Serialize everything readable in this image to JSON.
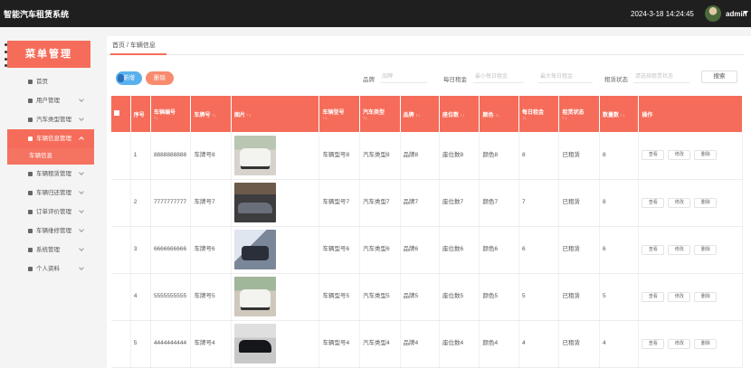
{
  "app": {
    "title": "智能汽车租赁系统",
    "datetime": "2024-3-18 14:24:45",
    "user": "admin"
  },
  "sidebar": {
    "banner": "菜单管理",
    "items": [
      {
        "label": "首页",
        "icon": "home-icon",
        "expandable": false
      },
      {
        "label": "用户管理",
        "icon": "user-icon",
        "expandable": true
      },
      {
        "label": "汽车类型管理",
        "icon": "grid-icon",
        "expandable": true
      },
      {
        "label": "车辆信息管理",
        "icon": "car-icon",
        "expandable": true,
        "active": true,
        "sub": "车辆信息"
      },
      {
        "label": "车辆租赁管理",
        "icon": "person-icon",
        "expandable": true
      },
      {
        "label": "车辆归还管理",
        "icon": "download-icon",
        "expandable": true
      },
      {
        "label": "订单评价管理",
        "icon": "grid-icon",
        "expandable": true
      },
      {
        "label": "车辆维修管理",
        "icon": "bulb-icon",
        "expandable": true
      },
      {
        "label": "系统管理",
        "icon": "chart-icon",
        "expandable": true
      },
      {
        "label": "个人资料",
        "icon": "profile-icon",
        "expandable": true
      }
    ]
  },
  "breadcrumb": "首页 / 车辆信息",
  "toolbar": {
    "add": "新增",
    "delete": "删除",
    "search": "搜索"
  },
  "filters": [
    {
      "label": "品牌",
      "placeholder": "品牌"
    },
    {
      "label": "每日租金",
      "placeholder": "最小每日租金"
    },
    {
      "label": "",
      "placeholder": "最大每日租金"
    },
    {
      "label": "租赁状态",
      "placeholder": "请选择租赁状态"
    }
  ],
  "table": {
    "headers": [
      "序号",
      "车辆编号",
      "车牌号",
      "图片",
      "车辆型号",
      "汽车类型",
      "品牌",
      "座位数",
      "颜色",
      "每日租金",
      "租赁状态",
      "数量数",
      "操作"
    ],
    "rows": [
      {
        "idx": "1",
        "code": "8888888888",
        "plate": "车牌号8",
        "img": "t8",
        "model": "车辆型号8",
        "type": "汽车类型8",
        "brand": "品牌8",
        "seats": "座位数8",
        "color": "颜色8",
        "rent": "8",
        "status": "已租赁",
        "qty": "8"
      },
      {
        "idx": "2",
        "code": "7777777777",
        "plate": "车牌号7",
        "img": "t7",
        "model": "车辆型号7",
        "type": "汽车类型7",
        "brand": "品牌7",
        "seats": "座位数7",
        "color": "颜色7",
        "rent": "7",
        "status": "已租赁",
        "qty": "8"
      },
      {
        "idx": "3",
        "code": "6666666666",
        "plate": "车牌号6",
        "img": "t6",
        "model": "车辆型号6",
        "type": "汽车类型6",
        "brand": "品牌6",
        "seats": "座位数6",
        "color": "颜色6",
        "rent": "6",
        "status": "已租赁",
        "qty": "6"
      },
      {
        "idx": "4",
        "code": "5555555555",
        "plate": "车牌号5",
        "img": "t5",
        "model": "车辆型号5",
        "type": "汽车类型5",
        "brand": "品牌5",
        "seats": "座位数5",
        "color": "颜色5",
        "rent": "5",
        "status": "已租赁",
        "qty": "5"
      },
      {
        "idx": "5",
        "code": "4444444444",
        "plate": "车牌号4",
        "img": "t4",
        "model": "车辆型号4",
        "type": "汽车类型4",
        "brand": "品牌4",
        "seats": "座位数4",
        "color": "颜色4",
        "rent": "4",
        "status": "已租赁",
        "qty": "4"
      }
    ],
    "actions": [
      "查看",
      "修改",
      "删除"
    ]
  },
  "colors": {
    "accent": "#f56d5a",
    "topbar": "#1f1f1f",
    "add_button": "#5ab0ee",
    "delete_button": "#f88a6e"
  }
}
